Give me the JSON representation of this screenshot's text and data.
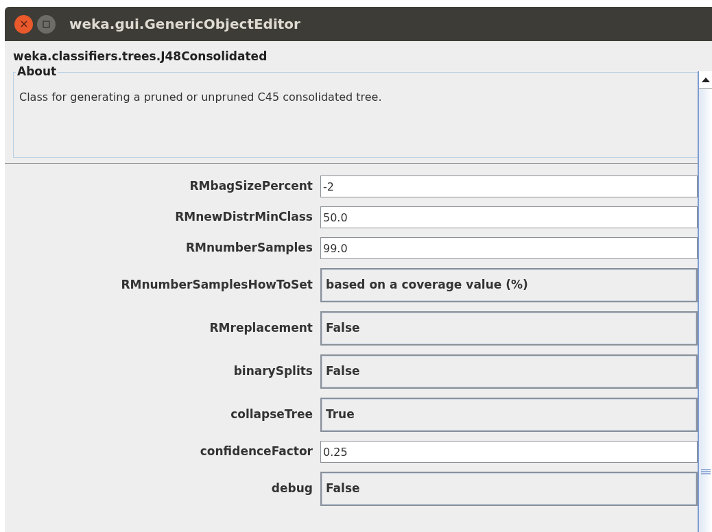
{
  "window": {
    "title": "weka.gui.GenericObjectEditor"
  },
  "class_name": "weka.classifiers.trees.J48Consolidated",
  "about": {
    "title": "About",
    "text": "Class for generating a pruned or unpruned C45 consolidated tree."
  },
  "properties": [
    {
      "label": "RMbagSizePercent",
      "kind": "text",
      "value": "-2"
    },
    {
      "label": "RMnewDistrMinClass",
      "kind": "text",
      "value": "50.0"
    },
    {
      "label": "RMnumberSamples",
      "kind": "text",
      "value": "99.0"
    },
    {
      "label": "RMnumberSamplesHowToSet",
      "kind": "choice",
      "value": "based on a coverage value (%)"
    },
    {
      "label": "RMreplacement",
      "kind": "choice",
      "value": "False"
    },
    {
      "label": "binarySplits",
      "kind": "choice",
      "value": "False"
    },
    {
      "label": "collapseTree",
      "kind": "choice",
      "value": "True"
    },
    {
      "label": "confidenceFactor",
      "kind": "text",
      "value": "0.25"
    },
    {
      "label": "debug",
      "kind": "choice",
      "value": "False"
    }
  ]
}
